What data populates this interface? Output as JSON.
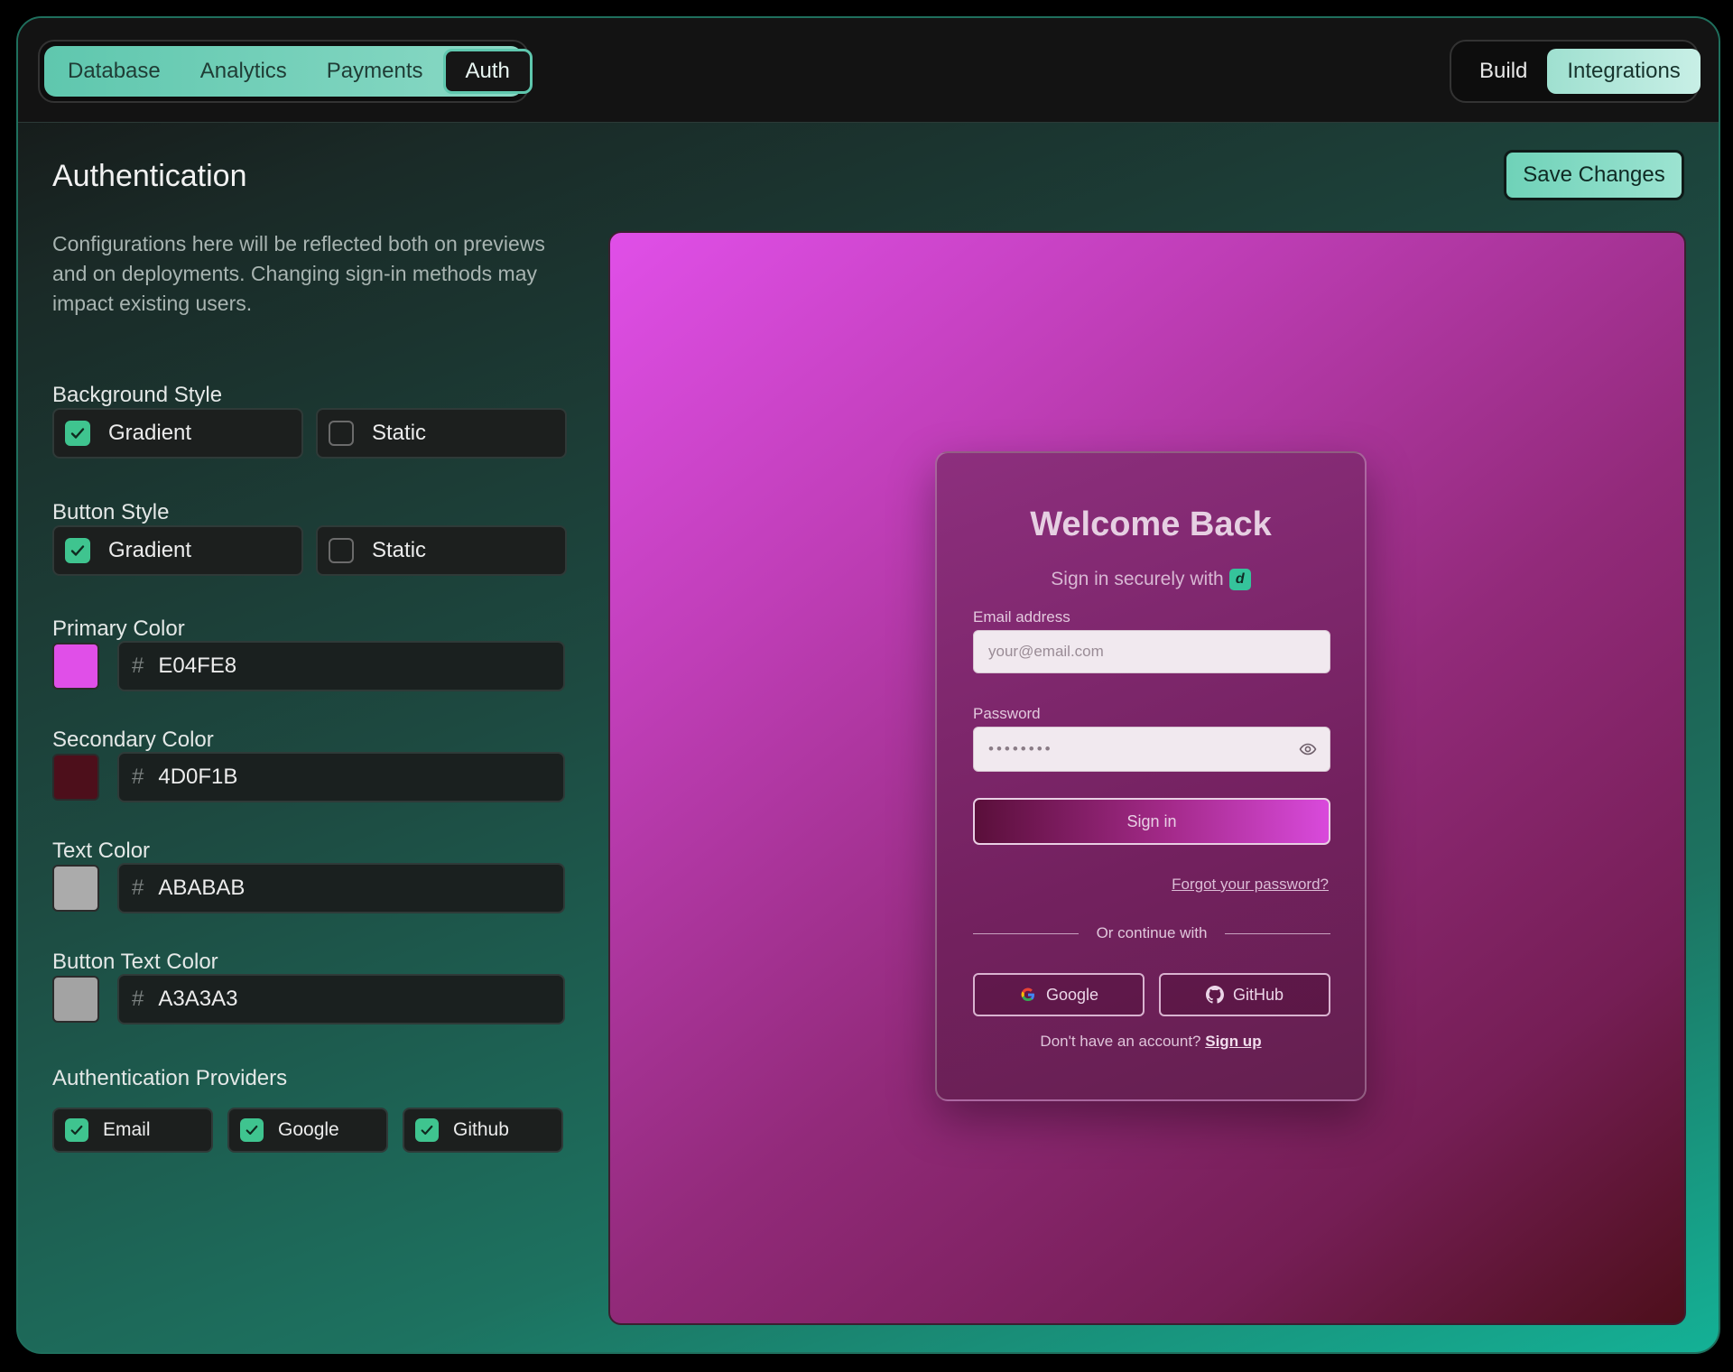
{
  "nav": {
    "left_tabs": [
      {
        "label": "Database",
        "active": false
      },
      {
        "label": "Analytics",
        "active": false
      },
      {
        "label": "Payments",
        "active": false
      },
      {
        "label": "Auth",
        "active": true
      }
    ],
    "right_tabs": [
      {
        "label": "Build",
        "active": false
      },
      {
        "label": "Integrations",
        "active": true
      }
    ]
  },
  "page": {
    "title": "Authentication",
    "save_label": "Save Changes",
    "description": "Configurations here will be reflected both on previews and on deployments. Changing sign-in methods may impact existing users."
  },
  "settings": {
    "background_style": {
      "label": "Background Style",
      "options": [
        {
          "label": "Gradient",
          "checked": true
        },
        {
          "label": "Static",
          "checked": false
        }
      ]
    },
    "button_style": {
      "label": "Button Style",
      "options": [
        {
          "label": "Gradient",
          "checked": true
        },
        {
          "label": "Static",
          "checked": false
        }
      ]
    },
    "primary_color": {
      "label": "Primary Color",
      "hash": "#",
      "value": "E04FE8",
      "swatch": "#E04FE8"
    },
    "secondary_color": {
      "label": "Secondary Color",
      "hash": "#",
      "value": "4D0F1B",
      "swatch": "#4D0F1B"
    },
    "text_color": {
      "label": "Text Color",
      "hash": "#",
      "value": "ABABAB",
      "swatch": "#ABABAB"
    },
    "button_text_color": {
      "label": "Button Text Color",
      "hash": "#",
      "value": "A3A3A3",
      "swatch": "#A3A3A3"
    },
    "providers": {
      "label": "Authentication Providers",
      "items": [
        {
          "label": "Email",
          "checked": true
        },
        {
          "label": "Google",
          "checked": true
        },
        {
          "label": "Github",
          "checked": true
        }
      ]
    }
  },
  "preview": {
    "title": "Welcome Back",
    "subtitle": "Sign in securely with",
    "brand_glyph": "d",
    "email_label": "Email address",
    "email_placeholder": "your@email.com",
    "password_label": "Password",
    "password_value": "••••••••",
    "signin_label": "Sign in",
    "forgot_label": "Forgot your password?",
    "divider_label": "Or continue with",
    "google_label": "Google",
    "github_label": "GitHub",
    "signup_prompt": "Don't have an account?",
    "signup_link": "Sign up"
  },
  "colors": {
    "accent": "#5FC7AE",
    "check": "#3FC48F"
  }
}
